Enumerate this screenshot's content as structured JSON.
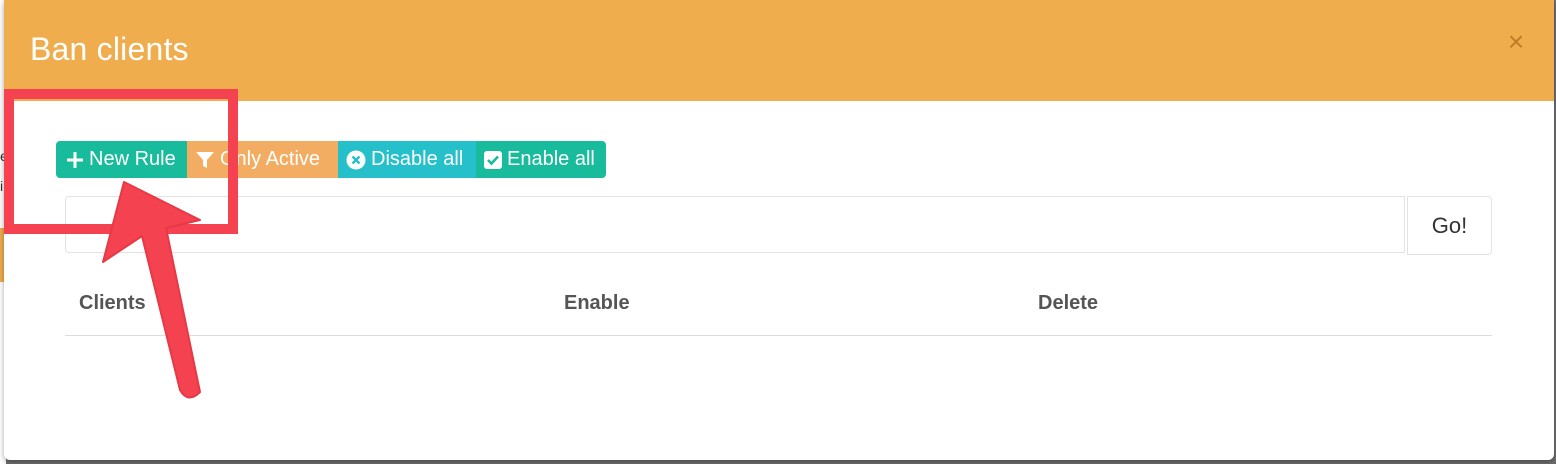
{
  "modal": {
    "title": "Ban clients",
    "close_symbol": "×"
  },
  "toolbar": {
    "buttons": [
      {
        "label": "New Rule",
        "icon": "plus-icon",
        "color": "#18bc9c"
      },
      {
        "label": "Only Active",
        "icon": "filter-icon",
        "color": "#f3ad62"
      },
      {
        "label": "Disable all",
        "icon": "x-circle-icon",
        "color": "#25c0c9"
      },
      {
        "label": "Enable all",
        "icon": "check-square-icon",
        "color": "#18bc9c"
      }
    ]
  },
  "search": {
    "value": "",
    "go_label": "Go!"
  },
  "table": {
    "columns": [
      "Clients",
      "Enable",
      "Delete"
    ]
  },
  "colors": {
    "header": "#efad4e",
    "annotation": "#f44250"
  }
}
